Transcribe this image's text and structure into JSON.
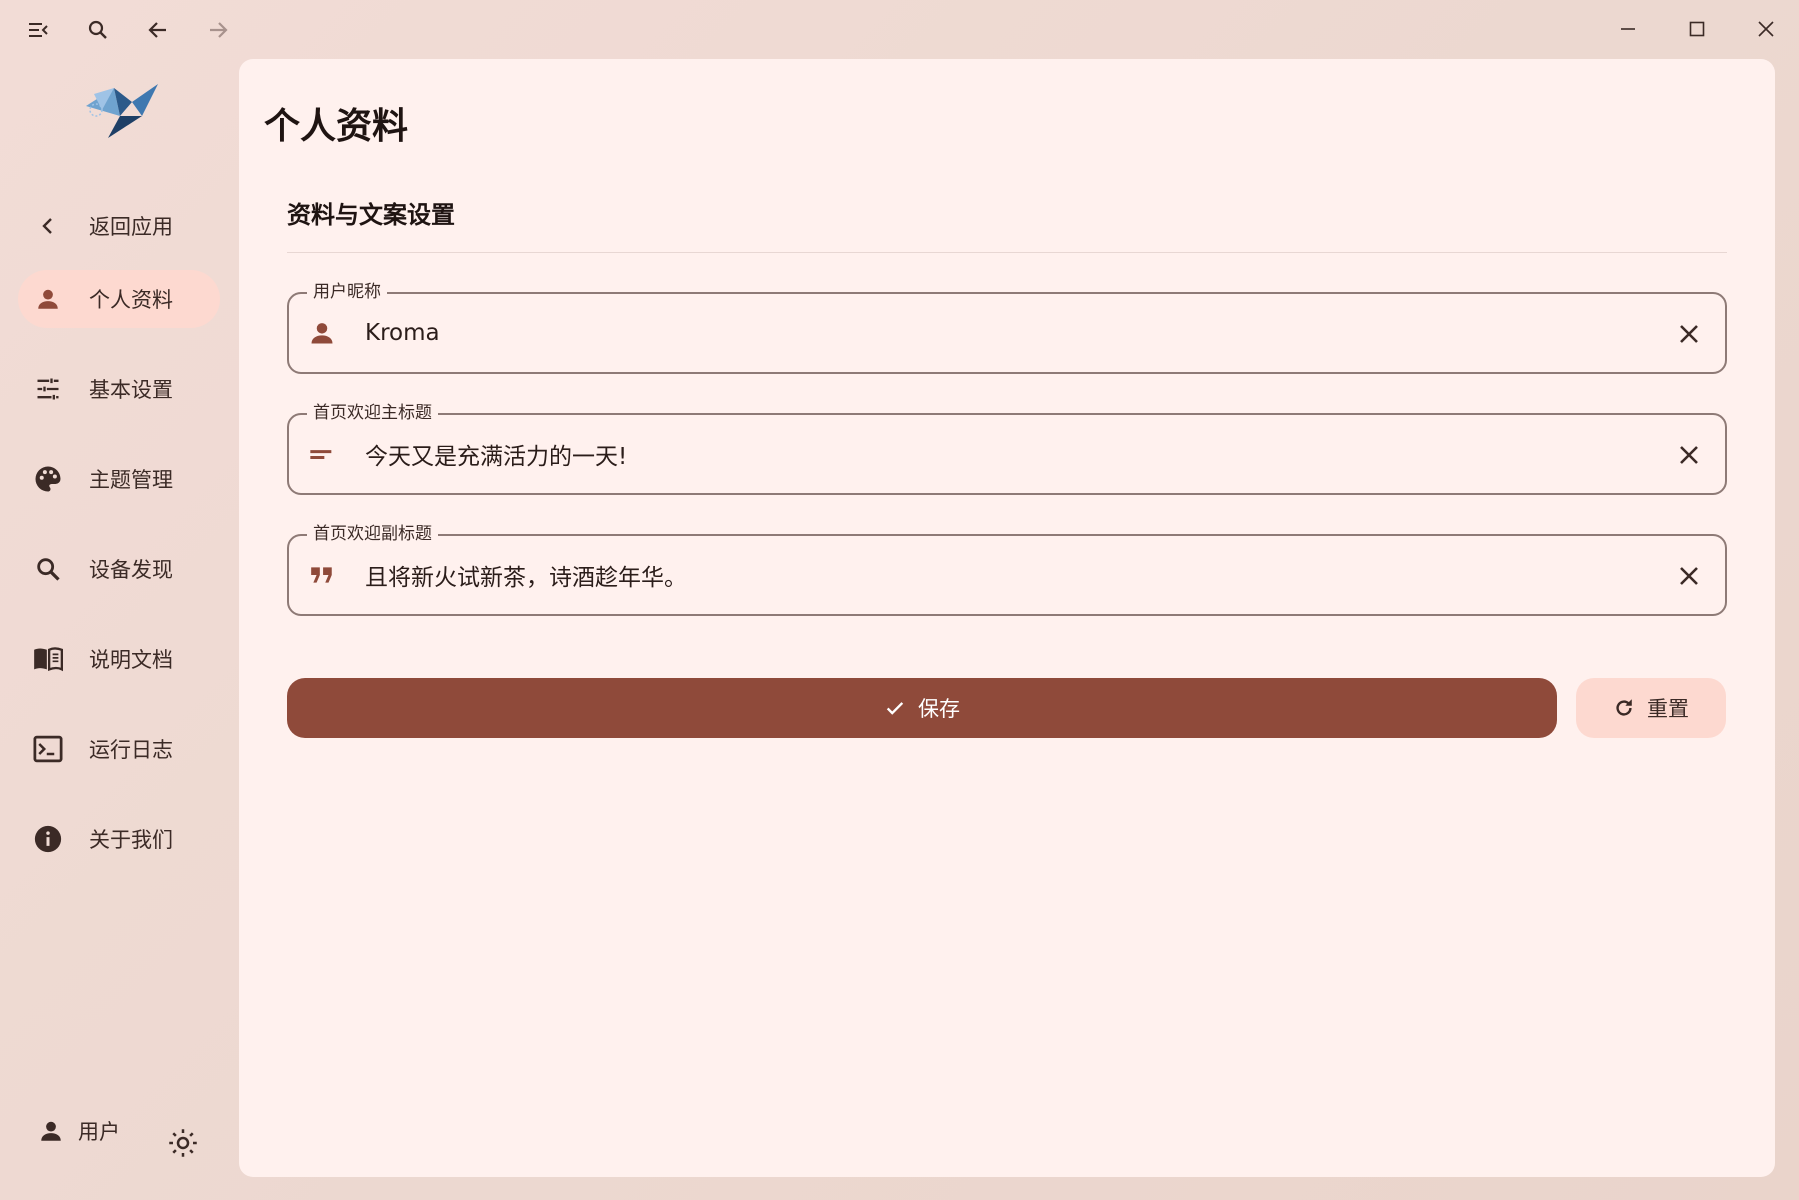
{
  "titlebar": {
    "menu_icon": "menu-collapse-icon",
    "search_icon": "search-icon",
    "back_icon": "arrow-back-icon",
    "forward_icon": "arrow-forward-icon",
    "minimize_icon": "minimize-icon",
    "maximize_icon": "maximize-icon",
    "close_icon": "close-icon"
  },
  "sidebar": {
    "logo": "origami-bird-logo",
    "back": {
      "label": "返回应用",
      "icon": "chevron-left-icon"
    },
    "items": [
      {
        "label": "个人资料",
        "icon": "person-icon",
        "active": true
      },
      {
        "label": "基本设置",
        "icon": "tune-icon",
        "active": false
      },
      {
        "label": "主题管理",
        "icon": "palette-icon",
        "active": false
      },
      {
        "label": "设备发现",
        "icon": "search-icon",
        "active": false
      },
      {
        "label": "说明文档",
        "icon": "book-icon",
        "active": false
      },
      {
        "label": "运行日志",
        "icon": "terminal-icon",
        "active": false
      },
      {
        "label": "关于我们",
        "icon": "info-icon",
        "active": false
      }
    ],
    "user": {
      "label": "用户",
      "icon": "person-icon"
    },
    "theme_toggle_icon": "sun-icon"
  },
  "main": {
    "page_title": "个人资料",
    "section_title": "资料与文案设置",
    "fields": [
      {
        "label": "用户昵称",
        "value": "Kroma",
        "icon": "person-icon"
      },
      {
        "label": "首页欢迎主标题",
        "value": "今天又是充满活力的一天!",
        "icon": "short-text-icon"
      },
      {
        "label": "首页欢迎副标题",
        "value": "且将新火试新茶，诗酒趁年华。",
        "icon": "quote-icon"
      }
    ],
    "save_label": "保存",
    "reset_label": "重置"
  },
  "colors": {
    "accent": "#8f4a3a",
    "accent_container": "#fdd9d0",
    "surface": "#fff1ee",
    "outline": "#8e7a76",
    "icon": "#8f4a3a"
  }
}
